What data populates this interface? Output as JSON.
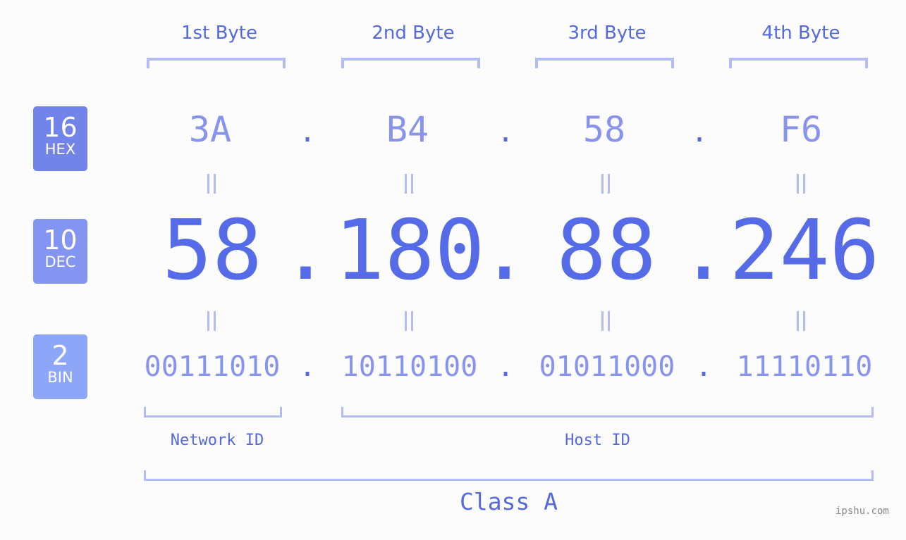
{
  "bases": [
    {
      "num": "16",
      "label": "HEX",
      "color": "#7283ea"
    },
    {
      "num": "10",
      "label": "DEC",
      "color": "#8494f1"
    },
    {
      "num": "2",
      "label": "BIN",
      "color": "#8ea6f8"
    }
  ],
  "byte_headers": [
    "1st Byte",
    "2nd Byte",
    "3rd Byte",
    "4th Byte"
  ],
  "hex": [
    "3A",
    "B4",
    "58",
    "F6"
  ],
  "dec": [
    "58",
    "180",
    "88",
    "246"
  ],
  "bin": [
    "00111010",
    "10110100",
    "01011000",
    "11110110"
  ],
  "separator": ".",
  "network_id_label": "Network ID",
  "host_id_label": "Host ID",
  "class_label": "Class A",
  "watermark": "ipshu.com"
}
